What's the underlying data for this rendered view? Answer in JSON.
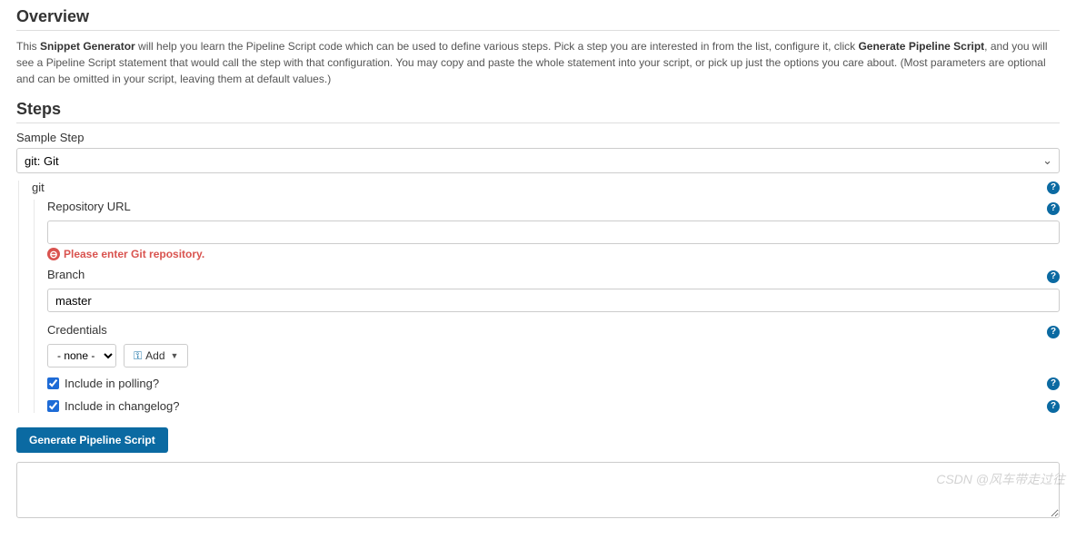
{
  "overview": {
    "title": "Overview",
    "desc_pre": "This ",
    "bold1": "Snippet Generator",
    "desc_mid": " will help you learn the Pipeline Script code which can be used to define various steps. Pick a step you are interested in from the list, configure it, click ",
    "bold2": "Generate Pipeline Script",
    "desc_post": ", and you will see a Pipeline Script statement that would call the step with that configuration. You may copy and paste the whole statement into your script, or pick up just the options you care about. (Most parameters are optional and can be omitted in your script, leaving them at default values.)"
  },
  "steps": {
    "title": "Steps",
    "sample_step_label": "Sample Step",
    "sample_step_value": "git: Git",
    "git_label": "git",
    "repo_url_label": "Repository URL",
    "repo_url_value": "",
    "repo_error": "Please enter Git repository.",
    "branch_label": "Branch",
    "branch_value": "master",
    "credentials_label": "Credentials",
    "credentials_value": "- none -",
    "add_label": "Add",
    "include_polling_label": "Include in polling?",
    "include_changelog_label": "Include in changelog?",
    "generate_button": "Generate Pipeline Script",
    "output_value": ""
  },
  "help_glyph": "?",
  "watermark": "CSDN @风车带走过往"
}
